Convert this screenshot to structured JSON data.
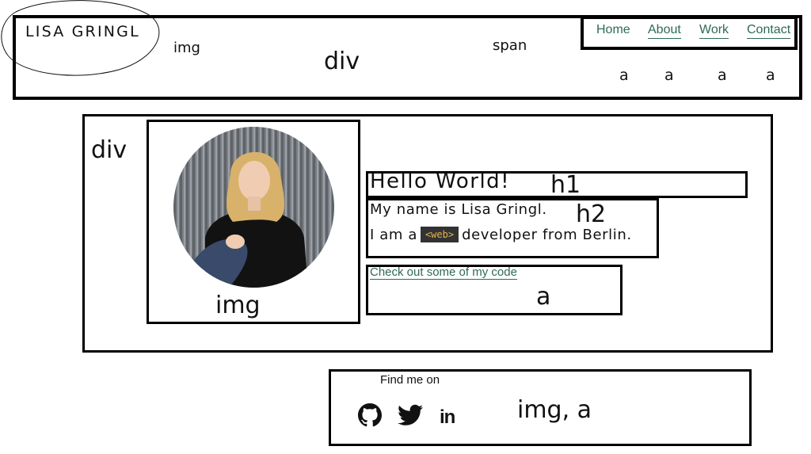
{
  "header": {
    "logo": "LISA GRINGL",
    "annotations": {
      "img": "img",
      "div": "div",
      "span": "span"
    },
    "nav": [
      {
        "label": "Home"
      },
      {
        "label": "About"
      },
      {
        "label": "Work"
      },
      {
        "label": "Contact"
      }
    ],
    "nav_annotations": [
      "a",
      "a",
      "a",
      "a"
    ]
  },
  "main": {
    "annotation_div": "div",
    "annotation_img": "img",
    "h1": "Hello World!",
    "h1_annotation": "h1",
    "h2_line1": "My name is Lisa Gringl.",
    "h2_line2_prefix": "I am a",
    "h2_badge": "<web>",
    "h2_line2_suffix": "developer from Berlin.",
    "h2_annotation": "h2",
    "cta_link": "Check out some of my code",
    "cta_annotation": "a"
  },
  "footer": {
    "find_text": "Find me on",
    "icons": [
      "github-icon",
      "twitter-icon",
      "linkedin-icon"
    ],
    "linkedin_text": "in",
    "annotation": "img, a"
  },
  "colors": {
    "link": "#2e6b55",
    "badge_bg": "#333333",
    "badge_text": "#e6b24d"
  }
}
